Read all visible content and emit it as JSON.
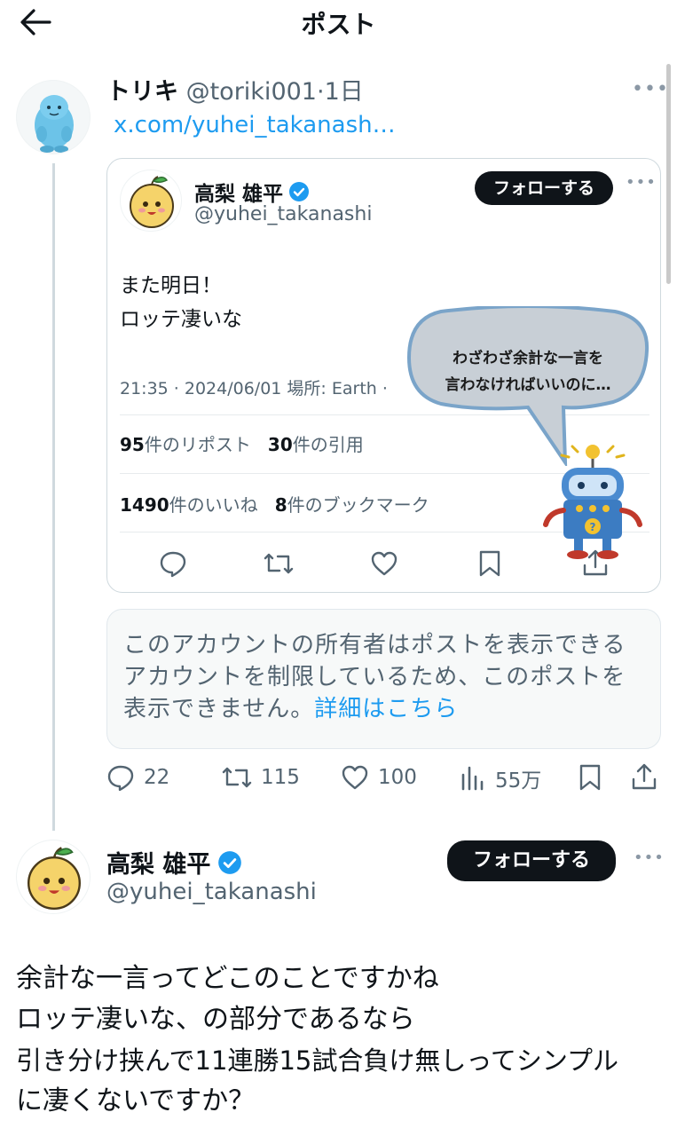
{
  "header": {
    "title": "ポスト"
  },
  "tweet": {
    "display_name": "トリキ",
    "handle": "@toriki001",
    "time": "·1日",
    "link_text": "x.com/yuhei_takanash…",
    "avatar_icon": "blue-plush-avatar-icon",
    "quoted": {
      "display_name": "高梨 雄平",
      "handle": "@yuhei_takanashi",
      "follow_label": "フォローする",
      "text_lines": [
        "また明日！",
        "ロッテ凄いな"
      ],
      "meta": "21:35 · 2024/06/01 場所: Earth ·",
      "stats": {
        "reposts_count": "95",
        "reposts_label": "件のリポスト",
        "quotes_count": "30",
        "quotes_label": "件の引用",
        "likes_count": "1490",
        "likes_label": "件のいいね",
        "bookmarks_count": "8",
        "bookmarks_label": "件のブックマーク"
      },
      "bubble_lines": [
        "わざわざ余計な一言を",
        "言わなければいいのに…"
      ]
    },
    "notice": {
      "text": "このアカウントの所有者はポストを表示できるアカウントを制限しているため、このポストを表示できません。",
      "link": "詳細はこちら"
    },
    "actions": {
      "replies": "22",
      "reposts": "115",
      "likes": "100",
      "views": "55万"
    }
  },
  "reply": {
    "display_name": "高梨 雄平",
    "handle": "@yuhei_takanashi",
    "follow_label": "フォローする",
    "text_lines": [
      "余計な一言ってどこのことですかね",
      "ロッテ凄いな、の部分であるなら",
      "引き分け挟んで11連勝15試合負け無しってシンプル",
      "に凄くないですか？"
    ]
  },
  "colors": {
    "accent": "#1d9bf0",
    "verified": "#1d9bf0",
    "text": "#0f1419",
    "muted": "#536471"
  }
}
